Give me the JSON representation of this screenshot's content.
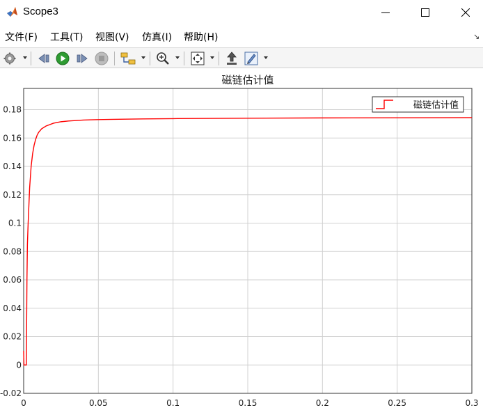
{
  "window": {
    "title": "Scope3",
    "logo_icon": "matlab-logo-icon",
    "controls": [
      "minimize-icon",
      "maximize-icon",
      "close-icon"
    ]
  },
  "menu": {
    "items": [
      {
        "label": "文件(F)"
      },
      {
        "label": "工具(T)"
      },
      {
        "label": "视图(V)"
      },
      {
        "label": "仿真(I)"
      },
      {
        "label": "帮助(H)"
      }
    ],
    "overflow_icon": "arrow-icon"
  },
  "toolbar": {
    "icons": [
      "gear-icon",
      "step-back-icon",
      "run-icon",
      "step-forward-icon",
      "stop-icon",
      "signal-select-icon",
      "zoom-in-icon",
      "autoscale-icon",
      "highlight-block-icon",
      "style-pen-icon"
    ]
  },
  "chart_data": {
    "type": "line",
    "title": "磁链估计值",
    "xlabel": "",
    "ylabel": "",
    "xlim": [
      0,
      0.3
    ],
    "ylim": [
      -0.02,
      0.195
    ],
    "xticks": [
      0,
      0.05,
      0.1,
      0.15,
      0.2,
      0.25,
      0.3
    ],
    "xtick_labels": [
      "0",
      "0.05",
      "0.1",
      "0.15",
      "0.2",
      "0.25",
      "0.3"
    ],
    "yticks": [
      -0.02,
      0,
      0.02,
      0.04,
      0.06,
      0.08,
      0.1,
      0.12,
      0.14,
      0.16,
      0.18
    ],
    "ytick_labels": [
      "-0.02",
      "0",
      "0.02",
      "0.04",
      "0.06",
      "0.08",
      "0.1",
      "0.12",
      "0.14",
      "0.16",
      "0.18"
    ],
    "grid": true,
    "legend_position": "top-right",
    "series": [
      {
        "name": "磁链估计值",
        "color": "#ff0000",
        "x": [
          0,
          0.0002,
          0.0004,
          0.0006,
          0.0008,
          0.001,
          0.0012,
          0.0014,
          0.0016,
          0.0018,
          0.002,
          0.0022,
          0.0025,
          0.003,
          0.004,
          0.005,
          0.006,
          0.007,
          0.008,
          0.009,
          0.01,
          0.012,
          0.015,
          0.02,
          0.025,
          0.03,
          0.04,
          0.05,
          0.06,
          0.08,
          0.1,
          0.15,
          0.2,
          0.25,
          0.3
        ],
        "y": [
          0.01,
          0,
          0,
          0,
          0,
          0,
          0,
          0,
          0,
          0,
          0.03,
          0.06,
          0.085,
          0.1,
          0.125,
          0.14,
          0.149,
          0.155,
          0.159,
          0.162,
          0.164,
          0.1665,
          0.1685,
          0.1705,
          0.1715,
          0.172,
          0.1727,
          0.173,
          0.1732,
          0.1735,
          0.1737,
          0.174,
          0.1742,
          0.1743,
          0.1744
        ]
      }
    ]
  }
}
